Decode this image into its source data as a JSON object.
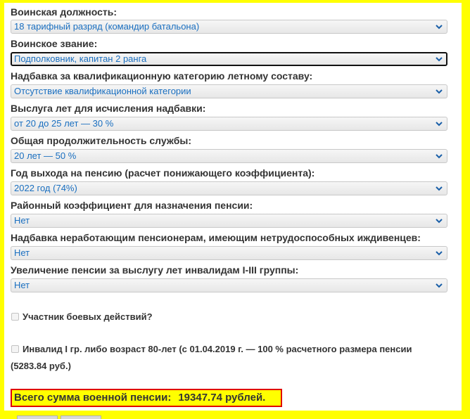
{
  "fields": [
    {
      "label": "Воинская должность:",
      "value": "18 тарифный разряд (командир батальона)"
    },
    {
      "label": "Воинское звание:",
      "value": "Подполковник, капитан 2 ранга"
    },
    {
      "label": "Надбавка за квалификационную категорию летному составу:",
      "value": "Отсутствие квалификационной категории"
    },
    {
      "label": "Выслуга лет для исчисления надбавки:",
      "value": "от 20 до 25 лет — 30 %"
    },
    {
      "label": "Общая продолжительность службы:",
      "value": "20 лет — 50 %"
    },
    {
      "label": "Год выхода на пенсию (расчет понижающего коэффициента):",
      "value": "2022 год (74%)"
    },
    {
      "label": "Районный коэффициент для назначения пенсии:",
      "value": "Нет"
    },
    {
      "label": "Надбавка неработающим пенсионерам, имеющим нетрудоспособных иждивенцев:",
      "value": "Нет"
    },
    {
      "label": "Увеличение пенсии за выслугу лет инвалидам I-III группы:",
      "value": "Нет"
    }
  ],
  "checkboxes": [
    {
      "label": "Участник боевых действий?",
      "checked": false
    },
    {
      "label_line1": "Инвалид I гр. либо возраст 80-лет (с 01.04.2019 г. — 100 % расчетного размера пенсии",
      "label_line2": "(5283.84 руб.)",
      "checked": false
    }
  ],
  "total": {
    "label": "Всего сумма военной пенсии:",
    "amount": "19347.74 рублей."
  },
  "colors": {
    "page_background": "#ffff00",
    "select_text": "#1a6fc0",
    "total_border": "#e00000"
  },
  "icons": {
    "select_arrow": "chevron-down-icon"
  }
}
